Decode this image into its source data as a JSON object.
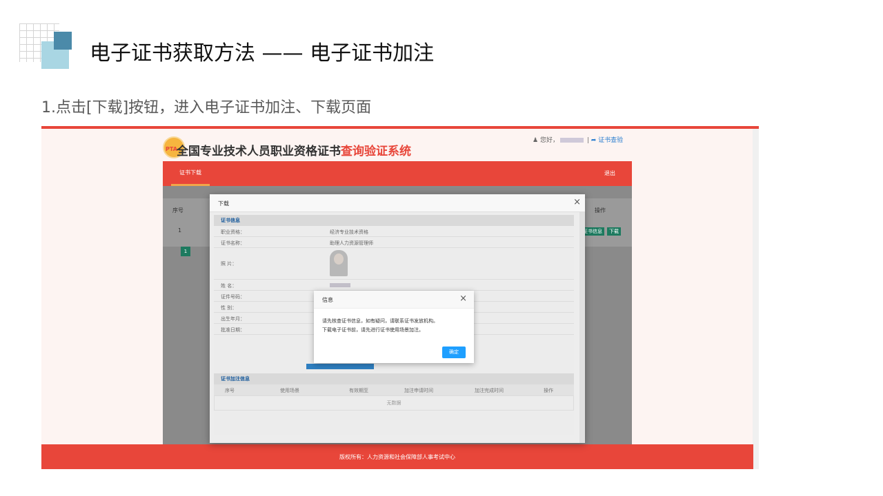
{
  "slide": {
    "title": "电子证书获取方法 —— 电子证书加注",
    "step": "1.点击[下载]按钮，进入电子证书加注、下载页面"
  },
  "site": {
    "logo_text": "PTA",
    "title_main": "全国专业技术人员职业资格证书",
    "title_accent": "查询验证系统",
    "greeting": "您好，",
    "verify_link": "证书查验",
    "nav_tab": "证书下载",
    "logout": "退出",
    "footer": "版权所有：人力资源和社会保障部人事考试中心"
  },
  "background_table": {
    "headers": {
      "index": "序号",
      "actions": "操作"
    },
    "row": {
      "index": "1",
      "info_btn": "证书信息",
      "download_btn": "下载"
    },
    "pager_current": "1"
  },
  "download_modal": {
    "title": "下载",
    "cert_section": "证书信息",
    "fields": [
      {
        "label": "职业资格：",
        "value": "经济专业技术资格"
      },
      {
        "label": "证书名称：",
        "value": "助理人力资源管理师"
      },
      {
        "label": "照      片：",
        "value": ""
      },
      {
        "label": "姓      名：",
        "value": ""
      },
      {
        "label": "证件号码：",
        "value": ""
      },
      {
        "label": "性      别：",
        "value": ""
      },
      {
        "label": "出生年月：",
        "value": ""
      },
      {
        "label": "批准日期：",
        "value": ""
      }
    ],
    "annotation_section": "证书加注信息",
    "annotation_headers": [
      "序号",
      "使用场景",
      "有效期至",
      "加注申请时间",
      "加注完成时间",
      "操作"
    ],
    "empty_text": "无数据"
  },
  "info_dialog": {
    "title": "信息",
    "line1": "请先核查证书信息，如有疑问，请联系证书发放机构。",
    "line2": "下载电子证书前，请先进行证书使用场景加注。",
    "ok": "确定"
  }
}
